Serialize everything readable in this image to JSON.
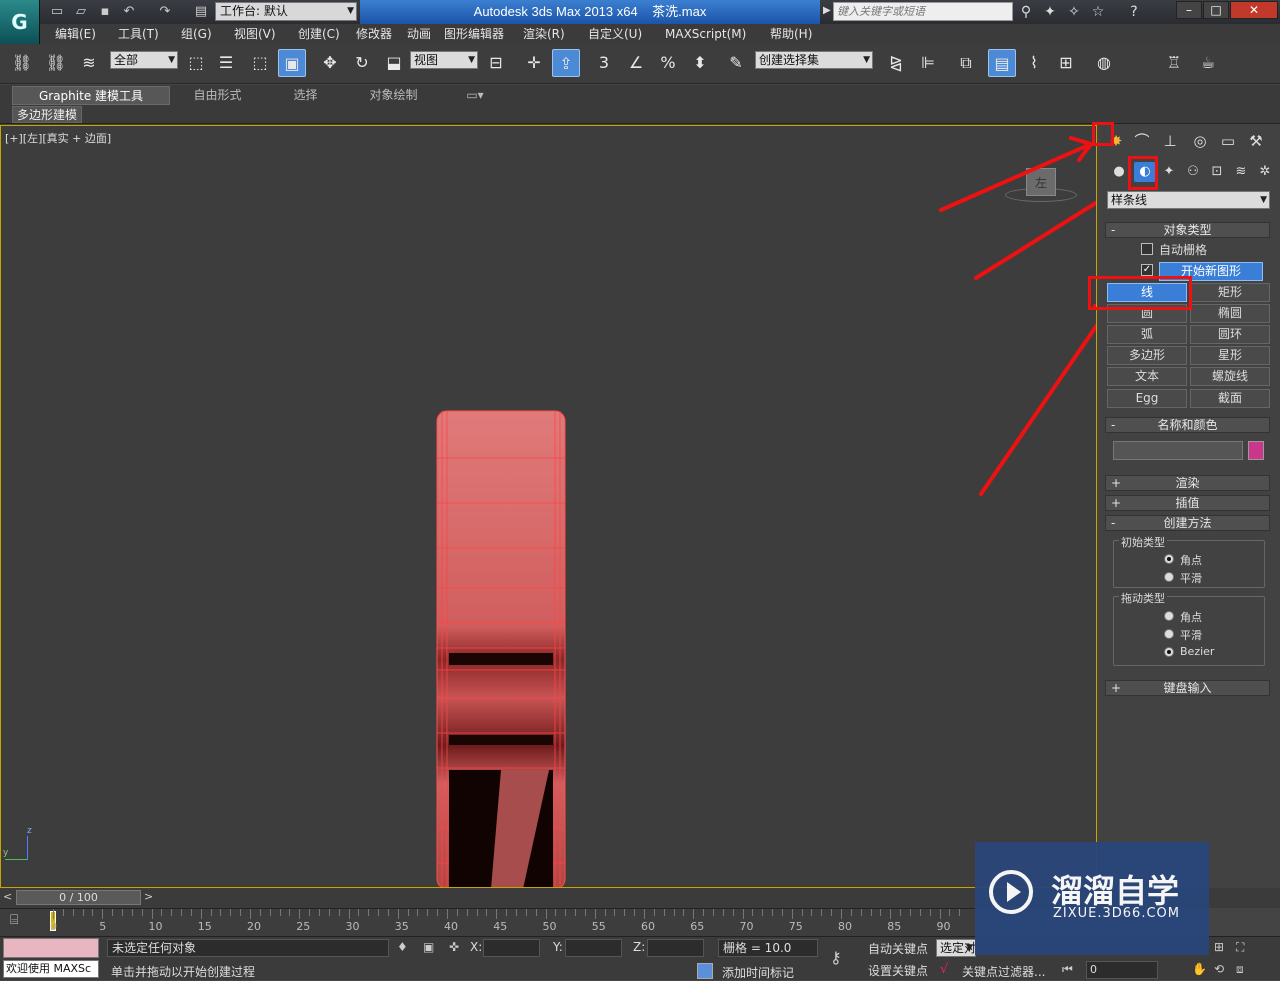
{
  "titlebar": {
    "workspace_label": "工作台: 默认",
    "app_title": "Autodesk 3ds Max  2013 x64",
    "file_name": "茶洗.max",
    "search_placeholder": "键入关键字或短语"
  },
  "menu": {
    "items": [
      "编辑(E)",
      "工具(T)",
      "组(G)",
      "视图(V)",
      "创建(C)",
      "修改器",
      "动画",
      "图形编辑器",
      "渲染(R)",
      "自定义(U)",
      "MAXScript(M)",
      "帮助(H)"
    ]
  },
  "toolbar": {
    "selection_filter": "全部",
    "ref_coord": "视图",
    "snap_number": "3",
    "named_selection": "创建选择集"
  },
  "ribbon": {
    "tabs": [
      "Graphite 建模工具",
      "自由形式",
      "选择",
      "对象绘制"
    ],
    "sub_label": "多边形建模"
  },
  "viewport": {
    "label": "[+][左][真实 + 边面]",
    "viewcube_label": "左",
    "axis_x": "y",
    "axis_z": "z"
  },
  "command_panel": {
    "category": "样条线",
    "object_type": {
      "title": "对象类型",
      "auto_grid": "自动栅格",
      "start_new_shape": "开始新图形",
      "buttons": [
        "线",
        "矩形",
        "圆",
        "椭圆",
        "弧",
        "圆环",
        "多边形",
        "星形",
        "文本",
        "螺旋线",
        "Egg",
        "截面"
      ]
    },
    "name_color": {
      "title": "名称和颜色",
      "swatch_color": "#c8378a"
    },
    "rollouts": {
      "render": "渲染",
      "interp": "插值",
      "create_method": "创建方法",
      "keyboard": "键盘输入"
    },
    "initial_type": {
      "title": "初始类型",
      "options": [
        "角点",
        "平滑"
      ]
    },
    "drag_type": {
      "title": "拖动类型",
      "options": [
        "角点",
        "平滑",
        "Bezier"
      ]
    }
  },
  "timeline": {
    "slider_text": "0 / 100",
    "ticks": [
      "0",
      "5",
      "10",
      "15",
      "20",
      "25",
      "30",
      "35",
      "40",
      "45",
      "50",
      "55",
      "60",
      "65",
      "70",
      "75",
      "80",
      "85",
      "90"
    ]
  },
  "status": {
    "welcome": "欢迎使用 MAXSc",
    "no_selection": "未选定任何对象",
    "prompt": "单击并拖动以开始创建过程",
    "x_label": "X:",
    "y_label": "Y:",
    "z_label": "Z:",
    "grid": "栅格 = 10.0",
    "auto_key": "自动关键点",
    "set_key": "设置关键点",
    "selected_obj": "选定对",
    "key_filters": "关键点过滤器...",
    "add_time_tag": "添加时间标记",
    "frame_value": "0"
  },
  "watermark": {
    "brand": "溜溜自学",
    "url": "ZIXUE.3D66.COM"
  },
  "colors": {
    "accent": "#3a7ed8",
    "annotation": "#ee1111",
    "object": "#d96a6a"
  }
}
